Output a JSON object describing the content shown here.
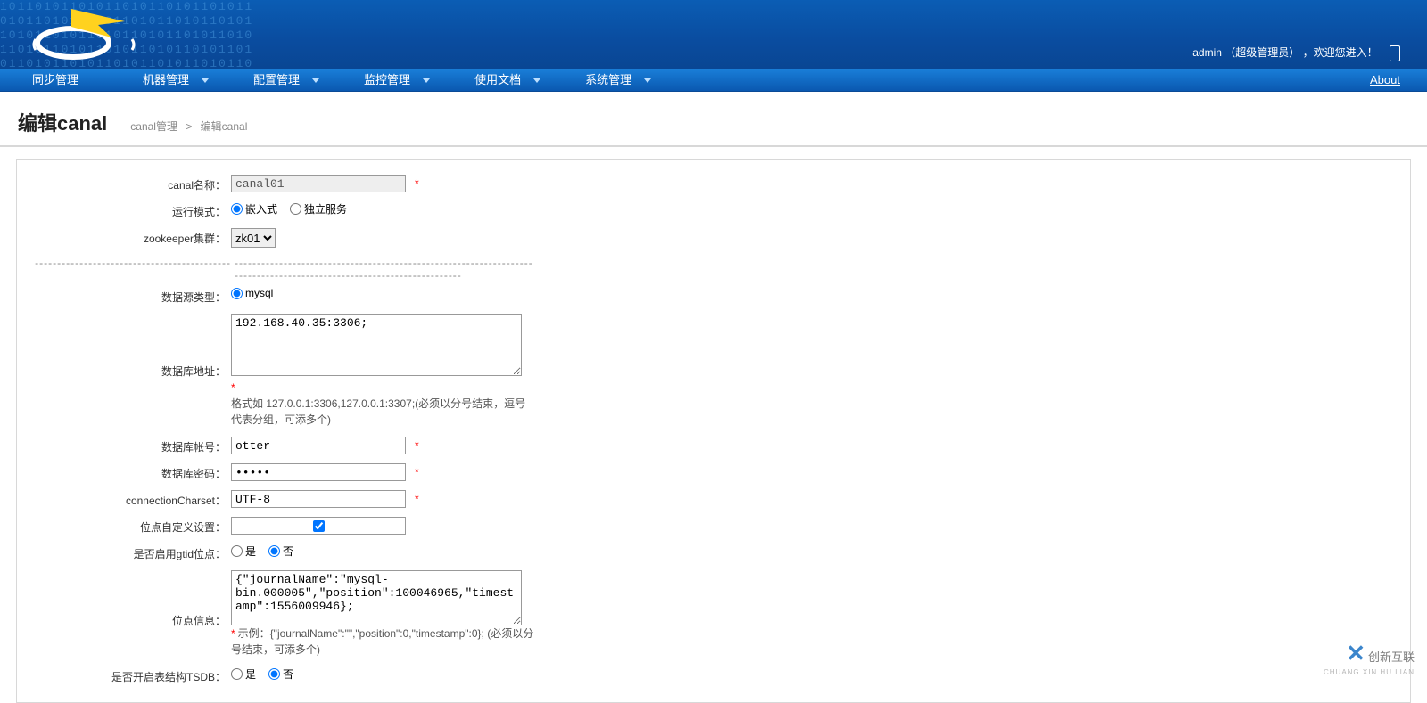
{
  "header": {
    "user_prefix": "admin",
    "user_role": "（超级管理员）",
    "welcome": "，欢迎您进入！"
  },
  "nav": {
    "items": [
      {
        "label": "同步管理",
        "has_children": false
      },
      {
        "label": "机器管理",
        "has_children": true
      },
      {
        "label": "配置管理",
        "has_children": true
      },
      {
        "label": "监控管理",
        "has_children": true
      },
      {
        "label": "使用文档",
        "has_children": true
      },
      {
        "label": "系统管理",
        "has_children": true
      }
    ],
    "about": "About"
  },
  "breadcrumb": {
    "page_title": "编辑canal",
    "parent": "canal管理",
    "sep": ">",
    "current": "编辑canal"
  },
  "form": {
    "canal_name": {
      "label": "canal名称：",
      "value": "canal01"
    },
    "run_mode": {
      "label": "运行模式：",
      "opt1": "嵌入式",
      "opt2": "独立服务"
    },
    "zk": {
      "label": "zookeeper集群：",
      "value": "zk01"
    },
    "ds_type": {
      "label": "数据源类型：",
      "opt1": "mysql"
    },
    "db_addr": {
      "label": "数据库地址：",
      "value": "192.168.40.35:3306;",
      "hint": "格式如 127.0.0.1:3306,127.0.0.1:3307;(必须以分号结束，逗号代表分组，可添多个)"
    },
    "db_user": {
      "label": "数据库帐号：",
      "value": "otter"
    },
    "db_pass": {
      "label": "数据库密码：",
      "value": "•••••"
    },
    "charset": {
      "label": "connectionCharset：",
      "value": "UTF-8"
    },
    "pos_custom": {
      "label": "位点自定义设置："
    },
    "gtid": {
      "label": "是否启用gtid位点：",
      "opt1": "是",
      "opt2": "否"
    },
    "pos_info": {
      "label": "位点信息：",
      "value": "{\"journalName\":\"mysql-bin.000005\",\"position\":100046965,\"timestamp\":1556009946};",
      "hint": "示例：{\"journalName\":\"\",\"position\":0,\"timestamp\":0}; (必须以分号结束，可添多个)"
    },
    "tsdb": {
      "label": "是否开启表结构TSDB：",
      "opt1": "是",
      "opt2": "否"
    }
  },
  "watermark": {
    "brand": "创新互联",
    "sub": "CHUANG XIN HU LIAN"
  }
}
